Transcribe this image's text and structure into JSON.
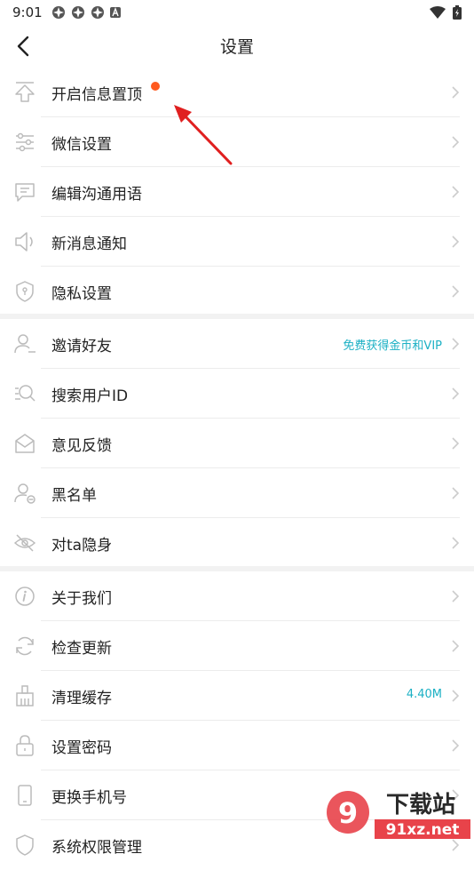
{
  "status": {
    "time": "9:01"
  },
  "header": {
    "title": "设置"
  },
  "sections": [
    {
      "items": [
        {
          "label": "开启信息置顶",
          "icon": "pin-top-icon",
          "badge": true
        },
        {
          "label": "微信设置",
          "icon": "sliders-icon"
        },
        {
          "label": "编辑沟通用语",
          "icon": "chat-bubble-icon"
        },
        {
          "label": "新消息通知",
          "icon": "speaker-icon"
        },
        {
          "label": "隐私设置",
          "icon": "shield-icon"
        }
      ]
    },
    {
      "items": [
        {
          "label": "邀请好友",
          "icon": "add-user-icon",
          "hint": "免费获得金币和VIP"
        },
        {
          "label": "搜索用户ID",
          "icon": "search-user-icon"
        },
        {
          "label": "意见反馈",
          "icon": "envelope-icon"
        },
        {
          "label": "黑名单",
          "icon": "block-user-icon"
        },
        {
          "label": "对ta隐身",
          "icon": "hidden-eye-icon"
        }
      ]
    },
    {
      "items": [
        {
          "label": "关于我们",
          "icon": "info-icon"
        },
        {
          "label": "检查更新",
          "icon": "refresh-icon"
        },
        {
          "label": "清理缓存",
          "icon": "broom-icon",
          "hint": "4.40M"
        },
        {
          "label": "设置密码",
          "icon": "lock-icon"
        },
        {
          "label": "更换手机号",
          "icon": "phone-icon"
        },
        {
          "label": "系统权限管理",
          "icon": "permission-icon"
        }
      ]
    }
  ],
  "colors": {
    "accent_hint": "#1bb0c4",
    "badge": "#ff5a1f",
    "annotation_arrow": "#e02020"
  },
  "watermark": {
    "line1": "下载站",
    "line2": "91xz.net"
  }
}
